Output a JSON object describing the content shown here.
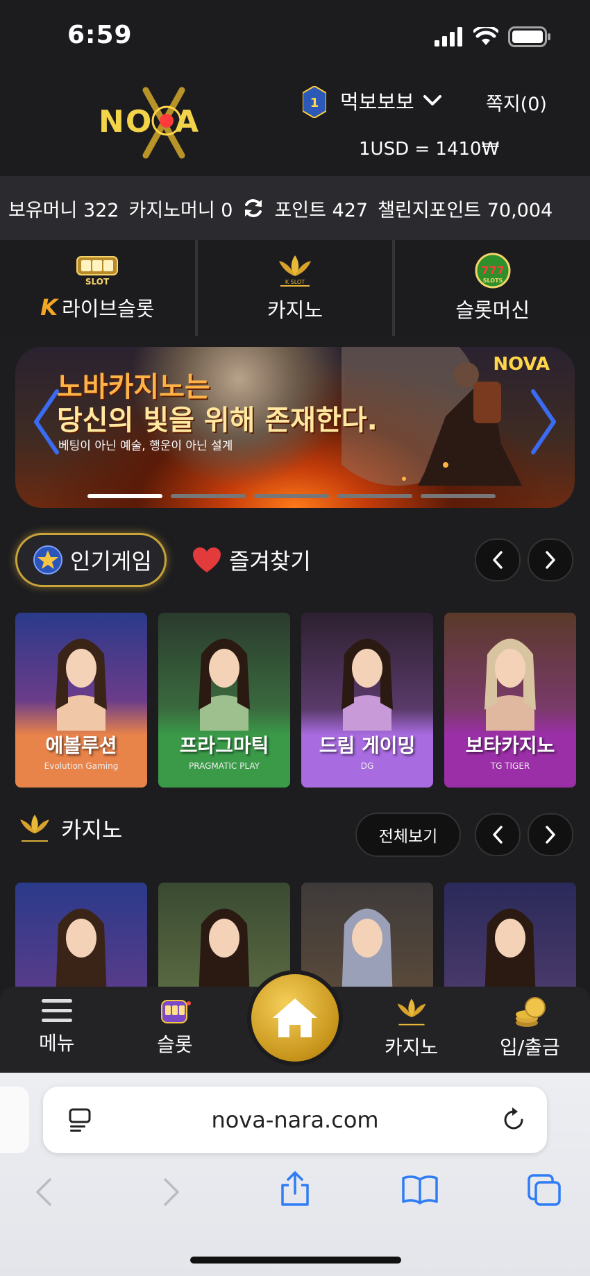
{
  "status_bar": {
    "time": "6:59"
  },
  "header": {
    "logo_text": "NOVA",
    "rank_level": "1",
    "user_name": "먹보보보",
    "message_link": "쪽지(0)",
    "exchange_rate": "1USD = 1410₩"
  },
  "balance": {
    "cash": "보유머니 322",
    "casino": "카지노머니 0",
    "points": "포인트 427",
    "challenge_points": "챌린지포인트 70,004"
  },
  "category_tabs": [
    {
      "label": "라이브슬롯",
      "icon": "live-slot-icon",
      "icon_text": "LIVE SLOT",
      "prefix": "K"
    },
    {
      "label": "카지노",
      "icon": "kslot-lotus-icon",
      "icon_text": "K SLOT"
    },
    {
      "label": "슬롯머신",
      "icon": "777-slots-icon",
      "icon_text": "777 SLOTS"
    }
  ],
  "banner": {
    "headline_1": "노바카지노는",
    "headline_2": "당신의 빛을 위해 존재한다.",
    "subline": "베팅이 아닌 예술, 행운이 아닌 설계",
    "logo": "NOVA",
    "slides": 5,
    "active_slide": 1
  },
  "sections": {
    "popular_tab": "인기게임",
    "favorites_tab": "즐겨찾기",
    "casino_title": "카지노",
    "view_all": "전체보기"
  },
  "popular_games": [
    {
      "title": "에볼루션",
      "provider": "Evolution Gaming",
      "bg": "#e8834a",
      "top": "#2b3a8a"
    },
    {
      "title": "프라그마틱",
      "provider": "PRAGMATIC PLAY",
      "bg": "#3a9a48",
      "top": "#2b3b2e"
    },
    {
      "title": "드림 게이밍",
      "provider": "DG",
      "bg": "#a86be0",
      "top": "#2d2130"
    },
    {
      "title": "보타카지노",
      "provider": "TG TIGER",
      "bg": "#9b2fa8",
      "top": "#5a3a2a"
    }
  ],
  "casino_games": [
    {
      "bg": "#2b3a8a"
    },
    {
      "bg": "#3a4a32"
    },
    {
      "bg": "#3e3a3a"
    },
    {
      "bg": "#2a2a5a"
    }
  ],
  "bottom_nav": {
    "menu": "메뉴",
    "slot": "슬롯",
    "casino": "카지노",
    "deposit": "입/출금"
  },
  "browser": {
    "url": "nova-nara.com"
  }
}
